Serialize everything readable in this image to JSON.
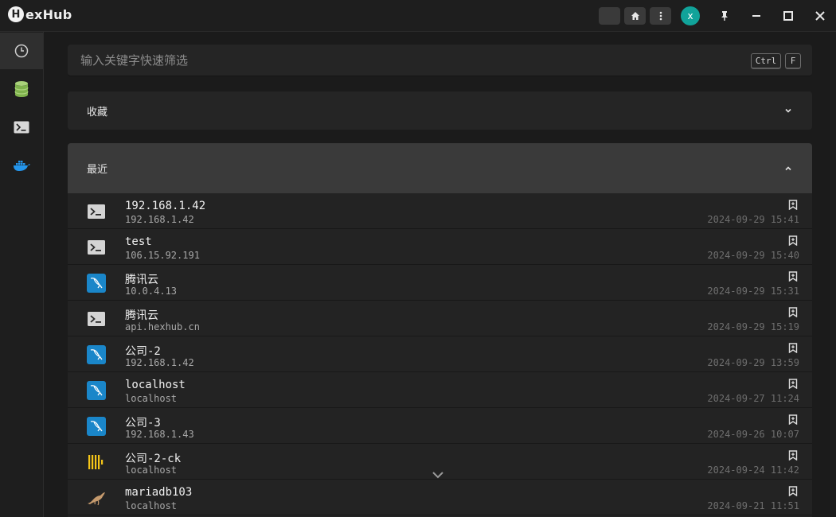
{
  "app": {
    "logo_letter": "H",
    "logo_text": "exHub"
  },
  "titlebar": {
    "buttons": [
      "moon-icon",
      "home-icon",
      "more-vertical-icon"
    ],
    "avatar_letter": "x",
    "window_buttons": [
      "pin-icon",
      "minimize-icon",
      "maximize-icon",
      "close-icon"
    ]
  },
  "sidebar": {
    "items": [
      "history-icon",
      "database-icon",
      "terminal-icon",
      "docker-icon"
    ]
  },
  "search": {
    "placeholder": "输入关键字快速筛选",
    "shortcut_ctrl": "Ctrl",
    "shortcut_key": "F"
  },
  "favorites": {
    "label": "收藏"
  },
  "recent": {
    "label": "最近"
  },
  "rows": [
    {
      "type": "ssh",
      "name": "192.168.1.42",
      "host": "192.168.1.42",
      "time": "2024-09-29 15:41"
    },
    {
      "type": "ssh",
      "name": "test",
      "host": "106.15.92.191",
      "time": "2024-09-29 15:40"
    },
    {
      "type": "mysql",
      "name": "腾讯云",
      "host": "10.0.4.13",
      "time": "2024-09-29 15:31"
    },
    {
      "type": "ssh",
      "name": "腾讯云",
      "host": "api.hexhub.cn",
      "time": "2024-09-29 15:19"
    },
    {
      "type": "mysql",
      "name": "公司-2",
      "host": "192.168.1.42",
      "time": "2024-09-29 13:59"
    },
    {
      "type": "mysql",
      "name": "localhost",
      "host": "localhost",
      "time": "2024-09-27 11:24"
    },
    {
      "type": "mysql",
      "name": "公司-3",
      "host": "192.168.1.43",
      "time": "2024-09-26 10:07"
    },
    {
      "type": "clickhouse",
      "name": "公司-2-ck",
      "host": "localhost",
      "time": "2024-09-24 11:42"
    },
    {
      "type": "mariadb",
      "name": "mariadb103",
      "host": "localhost",
      "time": "2024-09-21 11:51"
    }
  ],
  "colors": {
    "accent": "#11a39a",
    "mysql": "#1a86c9",
    "clickhouse": "#f5c518",
    "mariadb": "#c59a6d"
  }
}
